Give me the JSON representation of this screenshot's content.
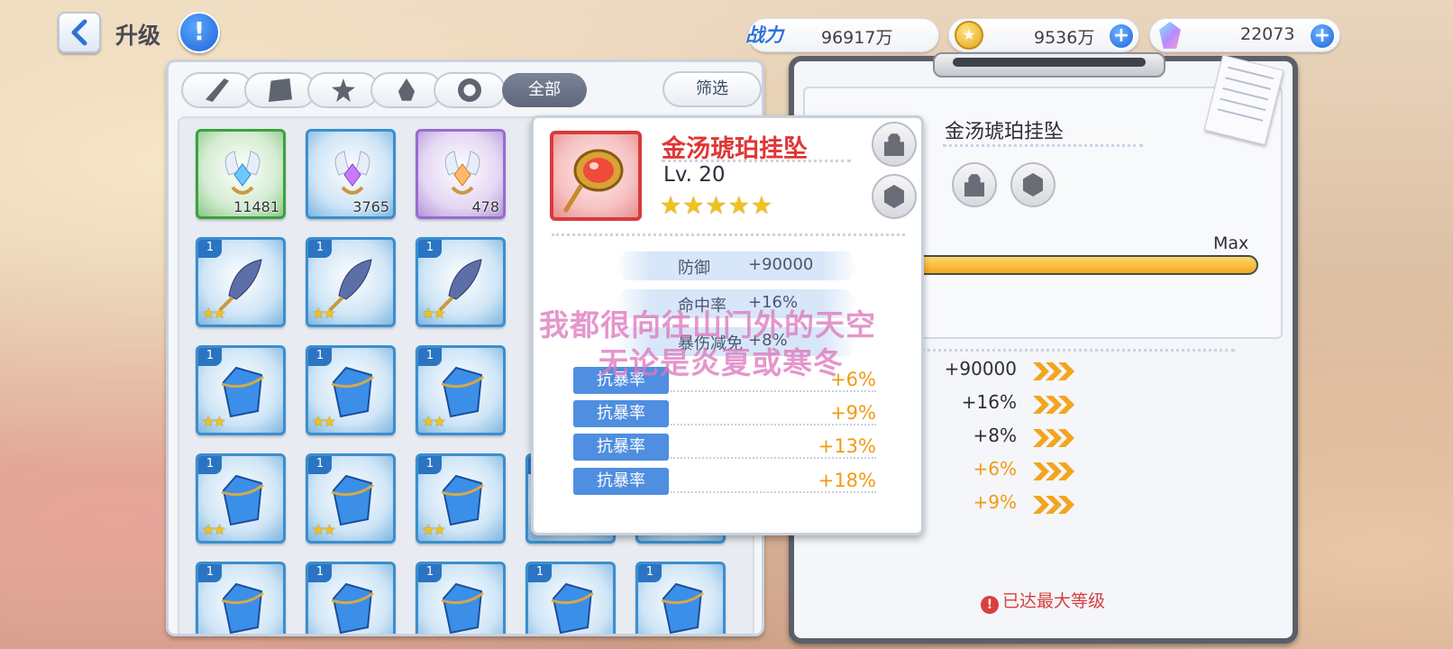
{
  "header": {
    "title": "升级",
    "help_label": "!",
    "power_label": "战力",
    "power_value": "96917万",
    "gold_value": "9536万",
    "gem_value": "22073",
    "plus_label": "+"
  },
  "inventory": {
    "tab_all_label": "全部",
    "filter_label": "筛选",
    "category_tabs": [
      "feather",
      "square",
      "star",
      "drop",
      "ring"
    ],
    "items": [
      {
        "kind": "material",
        "rarity": "green",
        "count": "11481"
      },
      {
        "kind": "material",
        "rarity": "blue",
        "count": "3765"
      },
      {
        "kind": "material",
        "rarity": "purple",
        "count": "478"
      },
      {
        "kind": "feather",
        "level": "1",
        "stars": "★★"
      },
      {
        "kind": "feather",
        "level": "1",
        "stars": "★★"
      },
      {
        "kind": "feather",
        "level": "1",
        "stars": "★★"
      },
      {
        "kind": "crystal",
        "level": "1",
        "stars": "★★"
      },
      {
        "kind": "crystal",
        "level": "1",
        "stars": "★★"
      },
      {
        "kind": "crystal",
        "level": "1",
        "stars": "★★"
      },
      {
        "kind": "crystal",
        "level": "1",
        "stars": "★★"
      },
      {
        "kind": "crystal",
        "level": "1",
        "stars": "★★"
      },
      {
        "kind": "crystal",
        "level": "1",
        "stars": "★★"
      },
      {
        "kind": "crystal",
        "level": "1",
        "stars": "★★"
      },
      {
        "kind": "crystal",
        "level": "1",
        "stars": "★★"
      },
      {
        "kind": "crystal",
        "level": "1"
      },
      {
        "kind": "crystal",
        "level": "1"
      },
      {
        "kind": "crystal",
        "level": "1"
      },
      {
        "kind": "crystal",
        "level": "1"
      },
      {
        "kind": "crystal",
        "level": "1"
      }
    ]
  },
  "detail": {
    "name": "金汤琥珀挂坠",
    "max_label": "Max",
    "progress": 1.0,
    "stats": [
      "+90000",
      "+16%",
      "+8%",
      "+6%",
      "+9%"
    ],
    "max_level_notice": "已达最大等级",
    "notice_icon": "!"
  },
  "popup": {
    "title": "金汤琥珀挂坠",
    "level": "Lv. 20",
    "stars": "★★★★★",
    "main_stats": [
      {
        "label": "防御",
        "value": "+90000"
      },
      {
        "label": "命中率",
        "value": "+16%"
      },
      {
        "label": "暴伤减免",
        "value": "+8%"
      }
    ],
    "sub_stats": [
      {
        "label": "抗暴率",
        "value": "+6%"
      },
      {
        "label": "抗暴率",
        "value": "+9%"
      },
      {
        "label": "抗暴率",
        "value": "+13%"
      },
      {
        "label": "抗暴率",
        "value": "+18%"
      }
    ]
  },
  "overlay": {
    "line1": "我都很向往山门外的天空",
    "line2": "无论是炎夏或寒冬"
  },
  "colors": {
    "accent_blue": "#2e72d6",
    "title_red": "#e03636",
    "value_orange": "#f29a12",
    "star_gold": "#f2c21b"
  }
}
